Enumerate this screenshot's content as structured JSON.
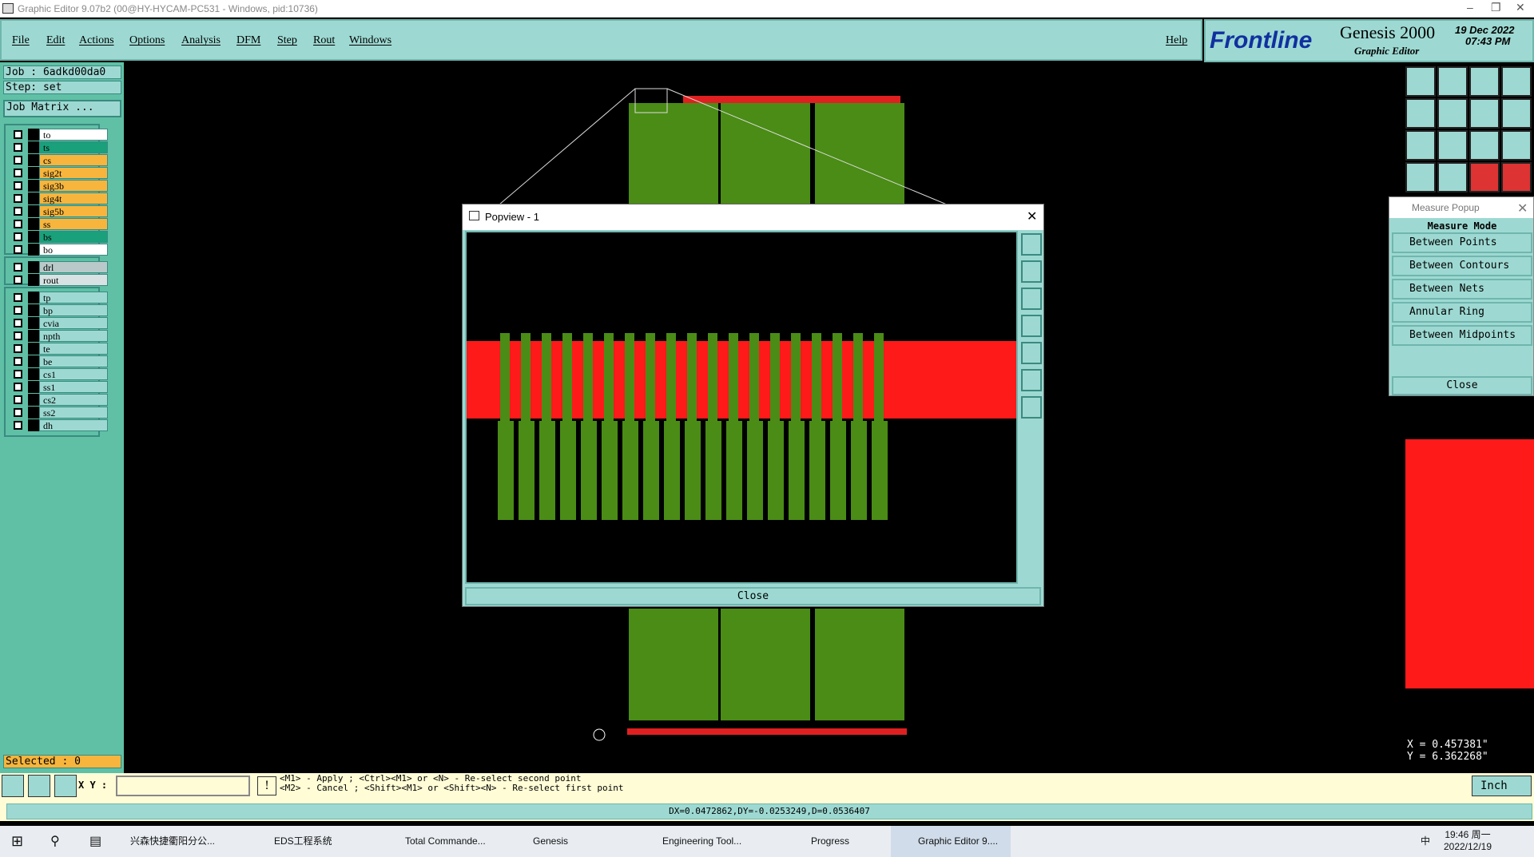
{
  "window": {
    "title": "Graphic Editor 9.07b2 (00@HY-HYCAM-PC531 - Windows, pid:10736)"
  },
  "menu": [
    "File",
    "Edit",
    "Actions",
    "Options",
    "Analysis",
    "DFM",
    "Step",
    "Rout",
    "Windows"
  ],
  "help": "Help",
  "brand": {
    "logo": "Frontline",
    "product": "Genesis 2000",
    "sub": "Graphic Editor",
    "date": "19 Dec 2022",
    "time": "07:43 PM"
  },
  "job": "Job : 6adkd00da0",
  "step": "Step: set",
  "job_matrix": "Job Matrix ...",
  "layers_a": [
    {
      "n": "to",
      "c": "#ffffff"
    },
    {
      "n": "ts",
      "c": "#1aa07a"
    },
    {
      "n": "cs",
      "c": "#f7b53d"
    },
    {
      "n": "sig2t",
      "c": "#f7b53d"
    },
    {
      "n": "sig3b",
      "c": "#f7b53d"
    },
    {
      "n": "sig4t",
      "c": "#f7b53d"
    },
    {
      "n": "sig5b",
      "c": "#f7b53d"
    },
    {
      "n": "ss",
      "c": "#f7b53d"
    },
    {
      "n": "bs",
      "c": "#1aa07a"
    },
    {
      "n": "bo",
      "c": "#ffffff"
    }
  ],
  "layers_b": [
    {
      "n": "drl",
      "c": "#b9c9c9"
    },
    {
      "n": "rout",
      "c": "#d9e2e2"
    }
  ],
  "layers_c": [
    {
      "n": "tp",
      "c": "#9dd9d2"
    },
    {
      "n": "bp",
      "c": "#9dd9d2"
    },
    {
      "n": "cvia",
      "c": "#9dd9d2"
    },
    {
      "n": "npth",
      "c": "#9dd9d2"
    },
    {
      "n": "te",
      "c": "#9dd9d2"
    },
    {
      "n": "be",
      "c": "#9dd9d2"
    },
    {
      "n": "cs1",
      "c": "#9dd9d2"
    },
    {
      "n": "ss1",
      "c": "#9dd9d2"
    },
    {
      "n": "cs2",
      "c": "#9dd9d2"
    },
    {
      "n": "ss2",
      "c": "#9dd9d2"
    },
    {
      "n": "dh",
      "c": "#9dd9d2"
    }
  ],
  "selected": "Selected : 0",
  "popview": {
    "title": "Popview - 1",
    "close": "Close"
  },
  "measure": {
    "title": "Measure Popup",
    "header": "Measure Mode",
    "items": [
      "Between Points",
      "Between Contours",
      "Between Nets",
      "Annular Ring",
      "Between Midpoints"
    ],
    "close": "Close"
  },
  "coords": {
    "x": "X = 0.457381\"",
    "y": "Y = 6.362268\""
  },
  "xy_label": "X Y :",
  "hint1": "<M1> - Apply  ; <Ctrl><M1> or <N> - Re-select second point",
  "hint2": "<M2> - Cancel ; <Shift><M1> or <Shift><N> - Re-select first point",
  "units": "Inch",
  "status": "DX=0.0472862,DY=-0.0253249,D=0.0536407",
  "taskbar": {
    "items": [
      "兴森快捷衢阳分公...",
      "EDS工程系统",
      "Total Commande...",
      "Genesis",
      "Engineering Tool...",
      "Progress",
      "Graphic Editor 9...."
    ],
    "clock_time": "19:46 周一",
    "clock_date": "2022/12/19",
    "ime": "中"
  }
}
